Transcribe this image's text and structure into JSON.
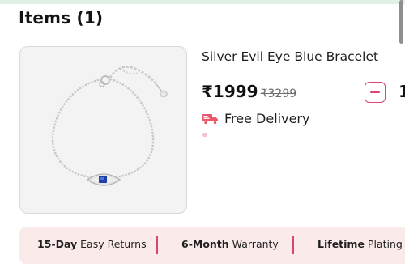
{
  "header": {
    "title": "Items (1)"
  },
  "item": {
    "name": "Silver Evil Eye Blue Bracelet",
    "price": "₹1999",
    "mrp": "₹3299",
    "quantity": "1",
    "delivery": "Free Delivery",
    "image_icon": "bracelet-image"
  },
  "benefits": [
    {
      "bold": "15-Day",
      "text": " Easy Returns"
    },
    {
      "bold": "6-Month",
      "text": " Warranty"
    },
    {
      "bold": "Lifetime",
      "text": " Plating Ser"
    }
  ],
  "colors": {
    "accent": "#d8456f",
    "benefits_bg": "#fbeaea",
    "top_strip": "#dff1e6",
    "truck_icon": "#e85a6a"
  }
}
